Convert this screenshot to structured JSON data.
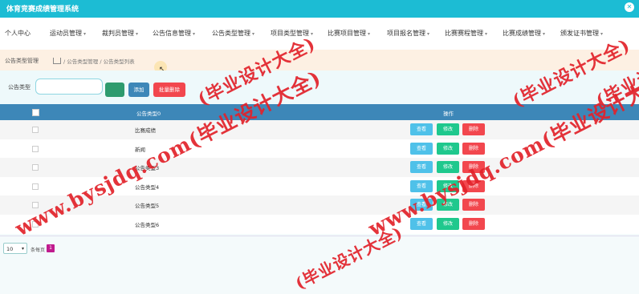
{
  "app": {
    "title": "体育竞赛成绩管理系统",
    "close_glyph": "✕"
  },
  "nav": {
    "items": [
      "个人中心",
      "运动员管理",
      "裁判员管理",
      "公告信息管理",
      "公告类型管理",
      "项目类型管理",
      "比赛项目管理",
      "项目报名管理",
      "比赛赛程管理",
      "比赛成绩管理",
      "颁发证书管理"
    ],
    "caret": "▾"
  },
  "breadcrumb": {
    "section": "公告类型管理",
    "trail": "/ 公告类型管理 / 公告类型列表"
  },
  "search": {
    "label": "公告类型",
    "input_value": "",
    "search_label": "",
    "add_label": "添加",
    "batch_delete_label": "批量删除"
  },
  "table": {
    "headers": {
      "name": "公告类型0",
      "ops": "操作"
    },
    "rows": [
      {
        "name": "比赛成绩"
      },
      {
        "name": "新闻"
      },
      {
        "name": "公告类型3"
      },
      {
        "name": "公告类型4"
      },
      {
        "name": "公告类型5"
      },
      {
        "name": "公告类型6"
      }
    ],
    "view_label": "查看",
    "edit_label": "修改",
    "delete_label": "删除"
  },
  "pager": {
    "page_size": "10",
    "per_page_label": "条每页",
    "current_page": "1"
  },
  "watermark": {
    "text1": "www.bysjdq.com(毕业设计大全)",
    "text2": "www.bysjdq.com(毕业设计大全)",
    "text3": "(毕业设计大全)",
    "text4": "(毕业设计大全)",
    "text5": "(毕业设计大全)",
    "text6": "(毕业设计大全)"
  },
  "colors": {
    "accent": "#1cbcd4",
    "header": "#3d87b8",
    "view": "#4fc1e9",
    "edit": "#1fc88d",
    "delete": "#f2474e",
    "watermark": "#e2222a"
  }
}
